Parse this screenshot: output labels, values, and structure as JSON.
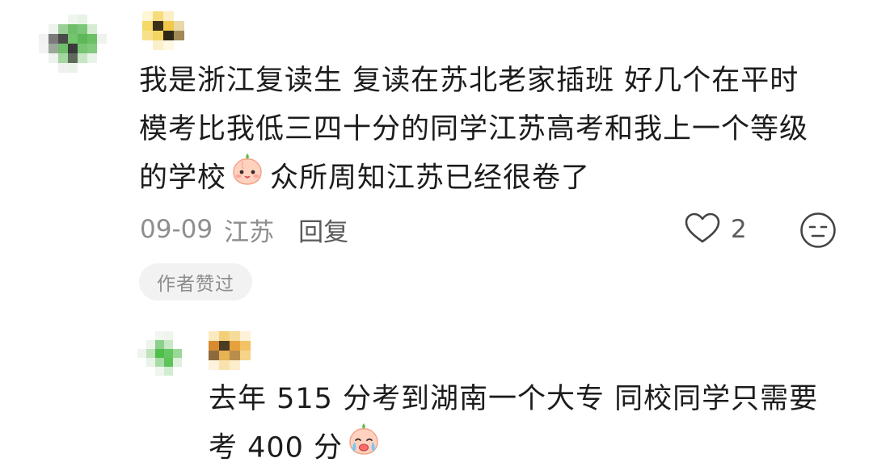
{
  "comment": {
    "lines": [
      "我是浙江复读生  复读在苏北老家插班  好几个在平时",
      "模考比我低三四十分的同学江苏高考和我上一个等级",
      "的学校"
    ],
    "line3_after_emoji": "众所周知江苏已经很卷了",
    "emoji": "smiling-peach-emoji",
    "date": "09-09",
    "location": "江苏",
    "reply_label": "回复",
    "like_count": "2",
    "author_liked_badge": "作者赞过"
  },
  "reply": {
    "line1": "去年 515 分考到湖南一个大专  同校同学只需要",
    "line2": "考 400 分",
    "emoji": "crying-peach-emoji"
  },
  "icons": {
    "like": "heart-outline-icon",
    "dislike": "neutral-face-icon"
  },
  "colors": {
    "text": "#1c1c1c",
    "meta": "#8e8e8e",
    "badge_bg": "#f2f2f2",
    "avatar_green": "#5cb85c"
  }
}
